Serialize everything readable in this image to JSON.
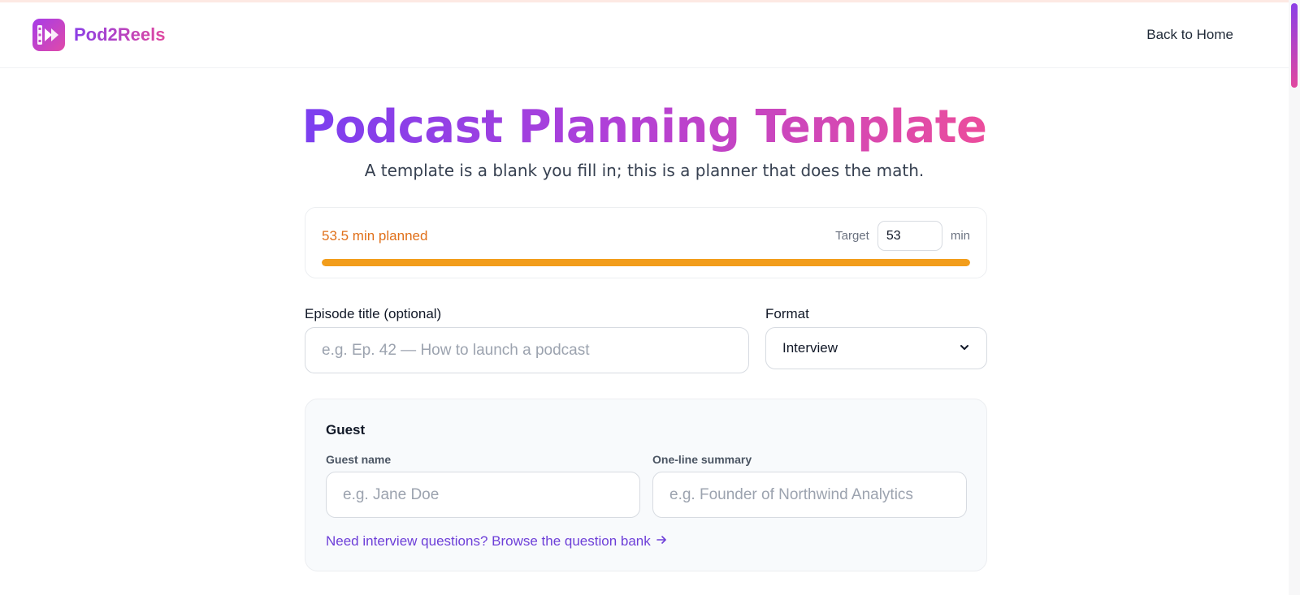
{
  "header": {
    "brand_name": "Pod2Reels",
    "back_link": "Back to Home"
  },
  "hero": {
    "title": "Podcast Planning Template",
    "subtitle": "A template is a blank you fill in; this is a planner that does the math."
  },
  "progress": {
    "planned_text": "53.5 min planned",
    "target_label": "Target",
    "target_value": "53",
    "unit": "min",
    "fill_percent": 100,
    "bar_color": "#f29d1b",
    "planned_color": "#e0701a"
  },
  "form": {
    "episode_title_label": "Episode title (optional)",
    "episode_title_placeholder": "e.g. Ep. 42 — How to launch a podcast",
    "format_label": "Format",
    "format_value": "Interview"
  },
  "guest": {
    "heading": "Guest",
    "name_label": "Guest name",
    "name_placeholder": "e.g. Jane Doe",
    "summary_label": "One-line summary",
    "summary_placeholder": "e.g. Founder of Northwind Analytics",
    "question_bank_link": "Need interview questions? Browse the question bank"
  },
  "colors": {
    "brand_gradient_start": "#8b3fe6",
    "brand_gradient_end": "#e0489f",
    "link": "#6d3fd8"
  },
  "icons": {
    "logo": "play-film-icon",
    "format_dropdown": "chevron-down-icon",
    "link_arrow": "arrow-right-icon"
  }
}
